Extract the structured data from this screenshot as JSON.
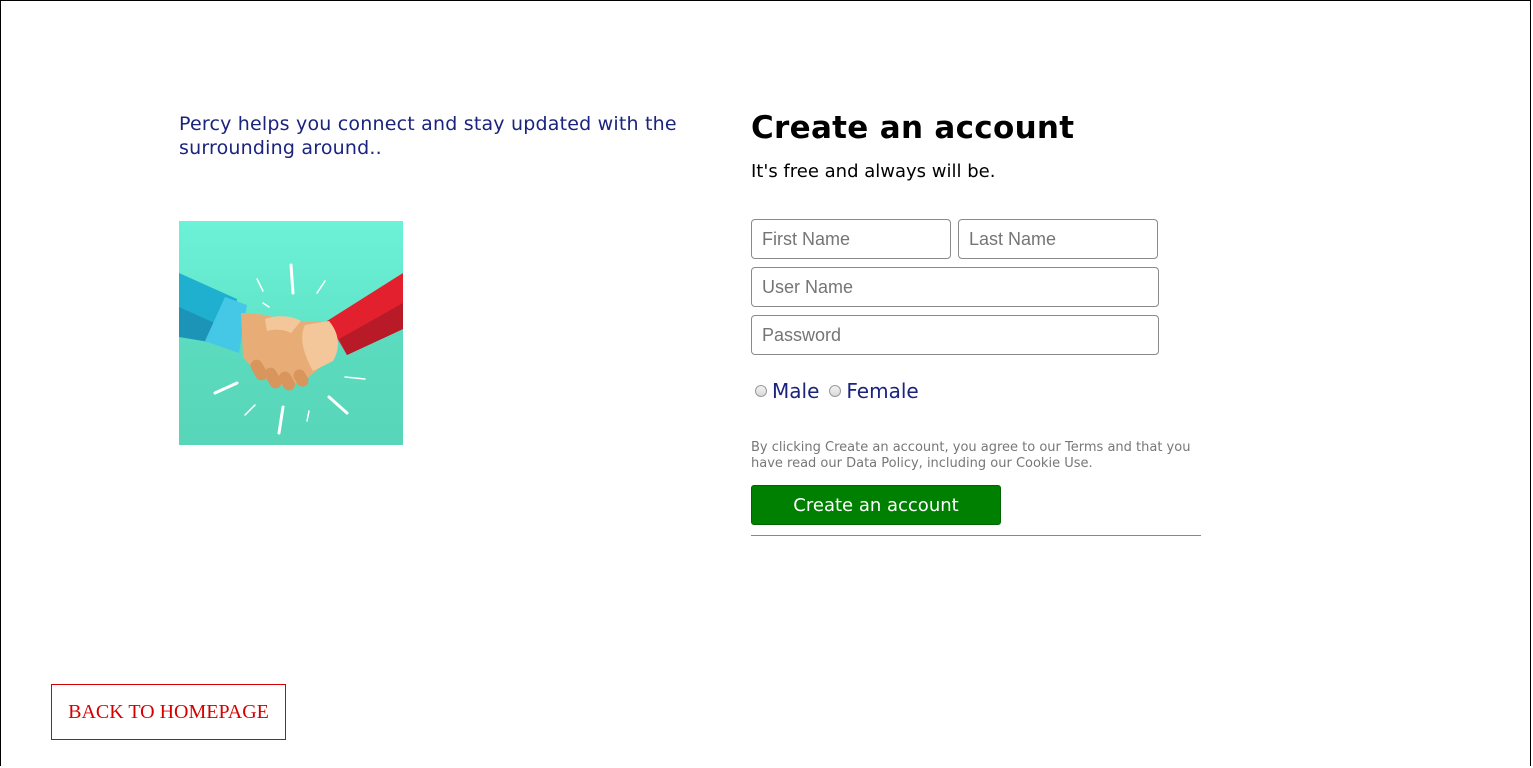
{
  "intro": {
    "tagline": "Percy helps you connect and stay updated with the surrounding around.."
  },
  "illustration": {
    "icon": "handshake-illustration",
    "colors": {
      "background_top": "#69f0d6",
      "background_bottom": "#58d9bb",
      "left_sleeve": "#1fb3d2",
      "right_sleeve": "#e0212f",
      "skin": "#e8b07a"
    }
  },
  "form": {
    "title": "Create an account",
    "subtitle": "It's free and always will be.",
    "first_name_placeholder": "First Name",
    "last_name_placeholder": "Last Name",
    "user_name_placeholder": "User Name",
    "password_placeholder": "Password",
    "gender_options": [
      "Male",
      "Female"
    ],
    "terms_text": "By clicking Create an account, you agree to our Terms and that you have read our Data Policy, including our Cookie Use.",
    "submit_label": "Create an account"
  },
  "nav": {
    "back_label": "BACK TO HOMEPAGE"
  },
  "colors": {
    "tagline": "#1a237e",
    "submit_bg": "#008000",
    "back_accent": "#d50000"
  }
}
